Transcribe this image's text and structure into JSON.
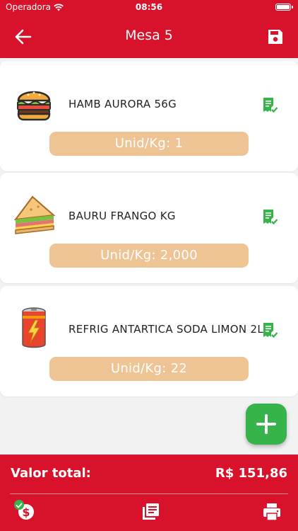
{
  "status_bar": {
    "carrier": "Operadora",
    "time": "08:56"
  },
  "header": {
    "title": "Mesa 5"
  },
  "items": [
    {
      "name": "HAMB AURORA 56G",
      "quantity": "Unid/Kg: 1",
      "image_icon": "burger-icon"
    },
    {
      "name": "BAURU FRANGO KG",
      "quantity": "Unid/Kg: 2,000",
      "image_icon": "sandwich-icon"
    },
    {
      "name": "REFRIG ANTARTICA SODA LIMON 2L",
      "quantity": "Unid/Kg: 22",
      "image_icon": "soda-can-icon"
    }
  ],
  "footer": {
    "total_label": "Valor total:",
    "total_value": "R$ 151,86"
  },
  "colors": {
    "primary_red": "#d8122a",
    "accent_green": "#36b34a",
    "quantity_pill": "#efc495"
  }
}
